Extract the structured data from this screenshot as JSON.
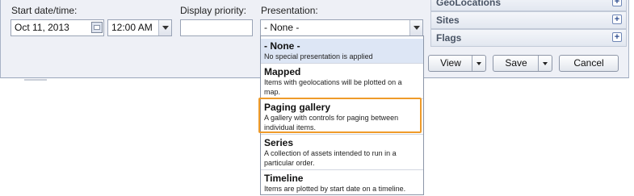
{
  "form": {
    "start_label": "Start date/time:",
    "start_date": "Oct 11, 2013",
    "start_time": "12:00 AM",
    "priority_label": "Display priority:",
    "priority_value": "",
    "presentation_label": "Presentation:",
    "presentation_value": "- None -"
  },
  "accordion": [
    {
      "label": "GeoLocations"
    },
    {
      "label": "Sites"
    },
    {
      "label": "Flags"
    }
  ],
  "buttons": {
    "view": "View",
    "save": "Save",
    "cancel": "Cancel"
  },
  "presentation_options": [
    {
      "title": "- None -",
      "desc": "No special presentation is applied"
    },
    {
      "title": "Mapped",
      "desc": "Items with geolocations will be plotted on a map."
    },
    {
      "title": "Paging gallery",
      "desc": "A gallery with controls for paging between individual items."
    },
    {
      "title": "Series",
      "desc": "A collection of assets intended to run in a particular order."
    },
    {
      "title": "Timeline",
      "desc": "Items are plotted by start date on a timeline."
    }
  ],
  "colors": {
    "highlight": "#ef9b2a",
    "selected_bg": "#dde6f5",
    "panel_bg": "#eef0f6"
  },
  "icons": [
    "calendar-icon",
    "chevron-down-icon",
    "plus-icon"
  ]
}
